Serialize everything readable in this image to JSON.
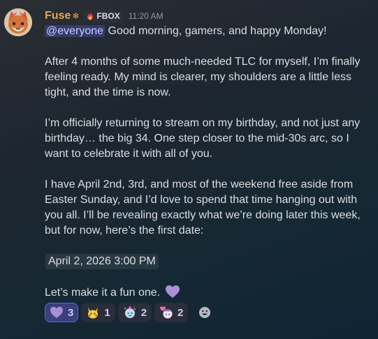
{
  "colors": {
    "username": "#e8a44b",
    "mention_bg": "#5865f2",
    "reaction_active_border": "#5865f2",
    "text": "#dbdee1",
    "muted": "#949ba4"
  },
  "author": {
    "name": "Fuse",
    "name_decoration": "❄",
    "avatar": "fox-avatar-icon",
    "tag_icon": "flame-icon",
    "tag": "FBOX",
    "timestamp": "11:20 AM"
  },
  "message": {
    "mention": "@everyone",
    "line1_rest": " Good morning, gamers, and happy Monday!",
    "p2": [
      "After 4 months of some much-needed TLC for myself, I’m finally",
      "feeling ready. My mind is clearer, my shoulders are a little less",
      "tight, and the time is now."
    ],
    "p3": [
      "I’m officially returning to stream on my birthday, and not just any",
      "birthday… the big 34. One step closer to the mid-30s arc, so I",
      "want to celebrate it with all of you."
    ],
    "p4": [
      "I have April 2nd, 3rd, and most of the weekend free aside from",
      "Easter Sunday, and I’d love to spend that time hanging out with",
      "you all. I’ll be revealing exactly what we’re doing later this week,",
      "but for now, here’s the first date:"
    ],
    "date_timestamp": "April 2, 2026 3:00 PM",
    "closing": "Let’s make it a fun one.",
    "closing_emoji": "purple-heart-icon"
  },
  "reactions": [
    {
      "emoji": "purple-heart-icon",
      "count": "3",
      "active": true
    },
    {
      "emoji": "pikachu-icon",
      "count": "1",
      "active": false
    },
    {
      "emoji": "party-character-icon",
      "count": "2",
      "active": false
    },
    {
      "emoji": "heart-character-icon",
      "count": "2",
      "active": false
    }
  ],
  "add_reaction_icon": "smiley-add-reaction-icon"
}
